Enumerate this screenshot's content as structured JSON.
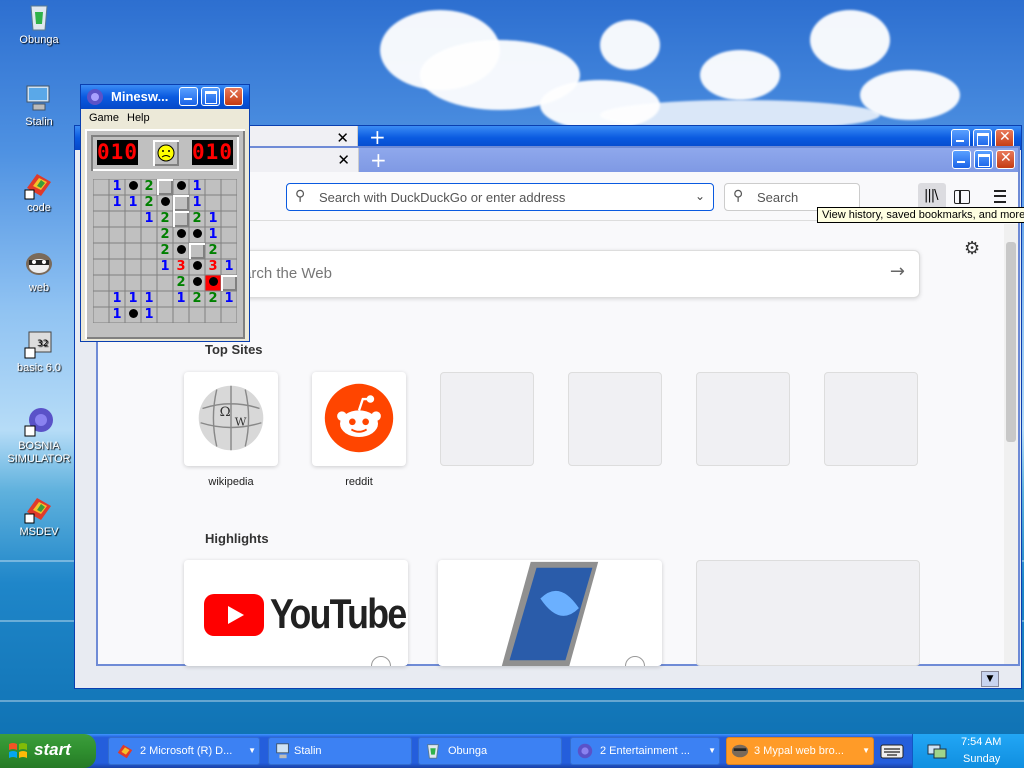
{
  "desktop": {
    "icons": [
      {
        "label": "Obunga",
        "icon": "recycle-bin-icon"
      },
      {
        "label": "Stalin",
        "icon": "computer-icon"
      },
      {
        "label": "code",
        "icon": "shortcut-app-icon"
      },
      {
        "label": "web",
        "icon": "raccoon-icon"
      },
      {
        "label": "basic 6.0",
        "icon": "vb6-shortcut-icon"
      },
      {
        "label": "BOSNIA SIMULATOR",
        "icon": "globe-shortcut-icon"
      },
      {
        "label": "MSDEV",
        "icon": "msdev-shortcut-icon"
      }
    ]
  },
  "minesweeper": {
    "title": "Minesw...",
    "menu": [
      "Game",
      "Help"
    ],
    "mines_left": "010",
    "timer": "010",
    "face": "sad-face",
    "board": [
      [
        "o",
        "1",
        "m",
        "2",
        "c",
        "m",
        "1",
        "o",
        "o"
      ],
      [
        "o",
        "1",
        "1",
        "2",
        "m",
        "c",
        "1",
        "o",
        "o"
      ],
      [
        "o",
        "o",
        "o",
        "1",
        "2",
        "c",
        "2",
        "1",
        "o"
      ],
      [
        "o",
        "o",
        "o",
        "o",
        "2",
        "m",
        "m",
        "1",
        "o"
      ],
      [
        "o",
        "o",
        "o",
        "o",
        "2",
        "m",
        "c",
        "2",
        "o"
      ],
      [
        "o",
        "o",
        "o",
        "o",
        "1",
        "3",
        "m",
        "3",
        "1"
      ],
      [
        "o",
        "o",
        "o",
        "o",
        "o",
        "2",
        "m",
        "x",
        "c"
      ],
      [
        "o",
        "1",
        "1",
        "1",
        "o",
        "1",
        "2",
        "2",
        "1"
      ],
      [
        "o",
        "1",
        "m",
        "1",
        "o",
        "o",
        "o",
        "o",
        "o"
      ]
    ]
  },
  "browser": {
    "address_placeholder": "Search with DuckDuckGo or enter address",
    "search_placeholder": "Search",
    "tooltip": "View history, saved bookmarks, and more",
    "web_search_placeholder": "arch the Web",
    "top_sites_title": "Top Sites",
    "top_sites": [
      {
        "label": "wikipedia",
        "icon": "wikipedia-globe-icon"
      },
      {
        "label": "reddit",
        "icon": "reddit-logo-icon"
      },
      {
        "label": ""
      },
      {
        "label": ""
      },
      {
        "label": ""
      },
      {
        "label": ""
      }
    ],
    "highlights_title": "Highlights",
    "youtube_text": "YouTube"
  },
  "taskbar": {
    "start_label": "start",
    "tasks": [
      {
        "label": "2 Microsoft (R) D...",
        "icon": "msdev-icon",
        "has_arrow": true
      },
      {
        "label": "Stalin",
        "icon": "computer-icon",
        "has_arrow": false
      },
      {
        "label": "Obunga",
        "icon": "recycle-bin-icon",
        "has_arrow": false
      },
      {
        "label": "2 Entertainment ...",
        "icon": "globe-icon",
        "has_arrow": true
      },
      {
        "label": "3 Mypal web bro...",
        "icon": "raccoon-icon",
        "has_arrow": true
      }
    ],
    "clock_time": "7:54 AM",
    "clock_day": "Sunday"
  },
  "colors": {
    "xp_blue": "#0a5ae0",
    "start_green": "#2f8f2f",
    "active_task": "#ff9b28",
    "youtube_red": "#ff0000",
    "reddit_orange": "#ff4500"
  }
}
